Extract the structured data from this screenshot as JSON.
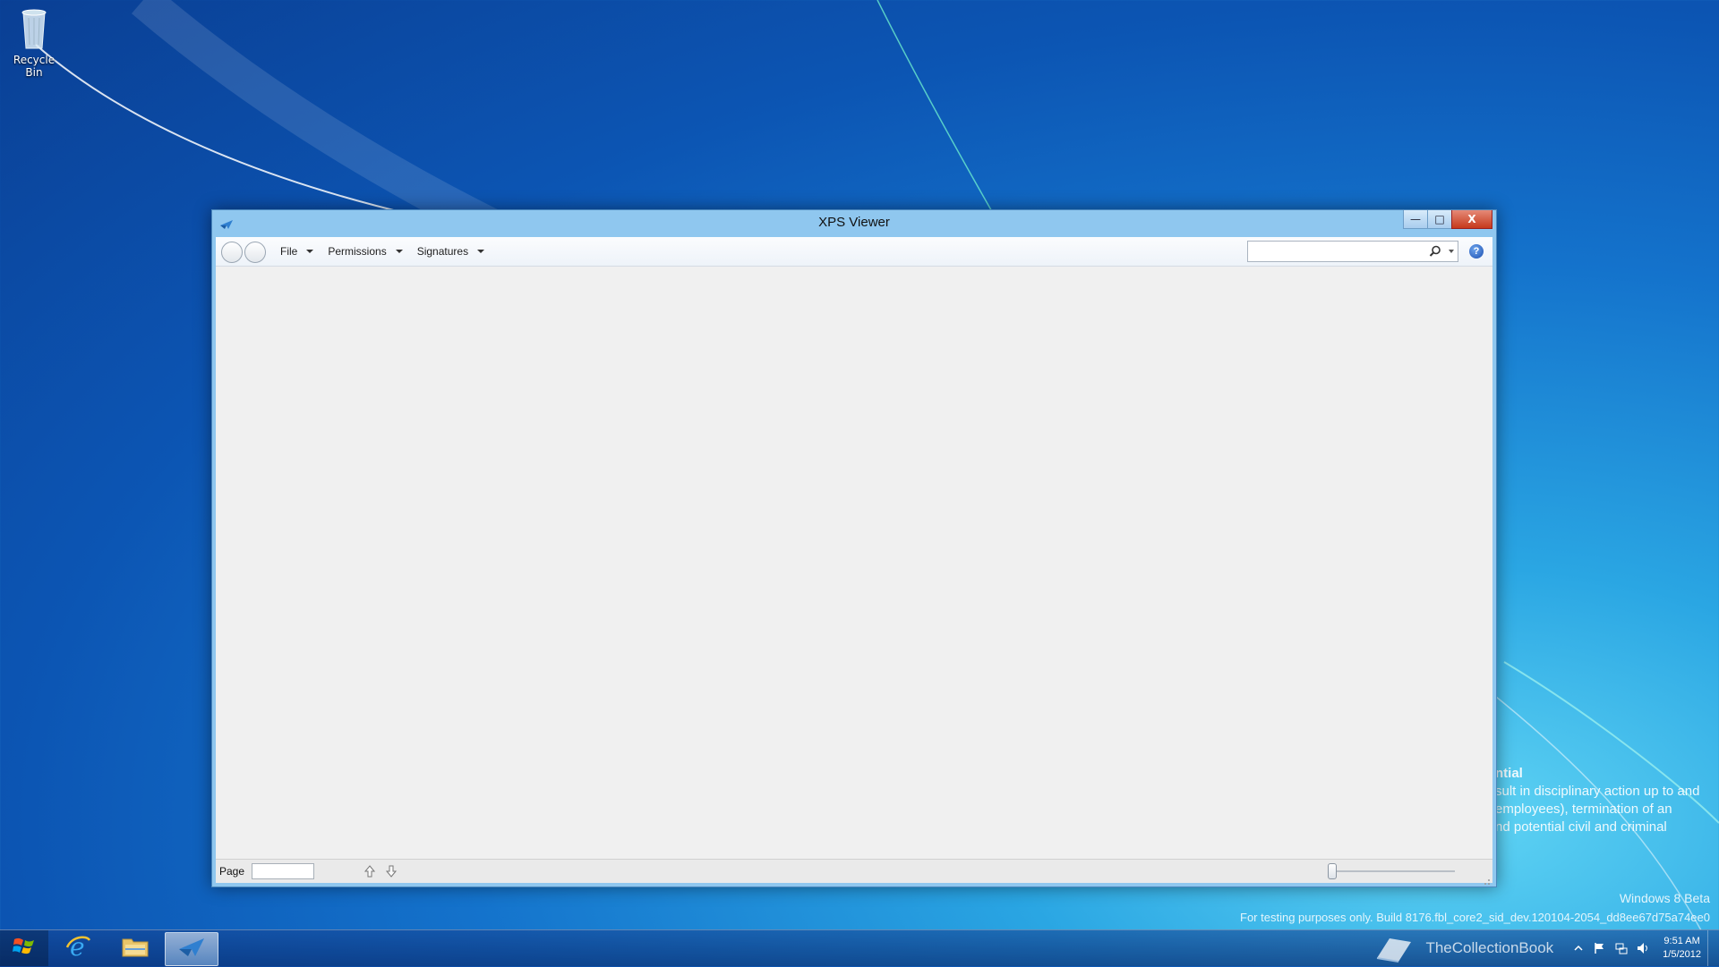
{
  "desktop": {
    "icons": [
      {
        "label": "Recycle Bin",
        "icon": "recycle-bin-icon"
      }
    ],
    "watermark_line1": "Windows 8 Beta",
    "watermark_line2": "For testing purposes only. Build 8176.fbl_core2_sid_dev.120104-2054_dd8ee67d75a74ee0",
    "background_text": [
      "ntial",
      "sult in disciplinary action up to and",
      "employees), termination of an",
      "nd potential civil and criminal"
    ],
    "brand_text": "TheCollectionBook"
  },
  "window": {
    "title": "XPS Viewer",
    "controls": {
      "minimize": "—",
      "maximize": "□",
      "close": "X"
    },
    "menu": [
      {
        "label": "File"
      },
      {
        "label": "Permissions"
      },
      {
        "label": "Signatures"
      }
    ],
    "search": {
      "value": "",
      "placeholder": ""
    },
    "help_label": "?",
    "status": {
      "page_label": "Page",
      "page_value": ""
    }
  },
  "taskbar": {
    "items": [
      {
        "name": "internet-explorer",
        "icon": "internet-explorer-icon"
      },
      {
        "name": "file-explorer",
        "icon": "folder-icon"
      },
      {
        "name": "xps-viewer",
        "icon": "xps-viewer-icon",
        "active": true
      }
    ],
    "clock": {
      "time": "9:51 AM",
      "date": "1/5/2012"
    }
  },
  "colors": {
    "accent": "#8fc7ef",
    "close": "#c6391c",
    "content_bg": "#f0f0f0"
  }
}
